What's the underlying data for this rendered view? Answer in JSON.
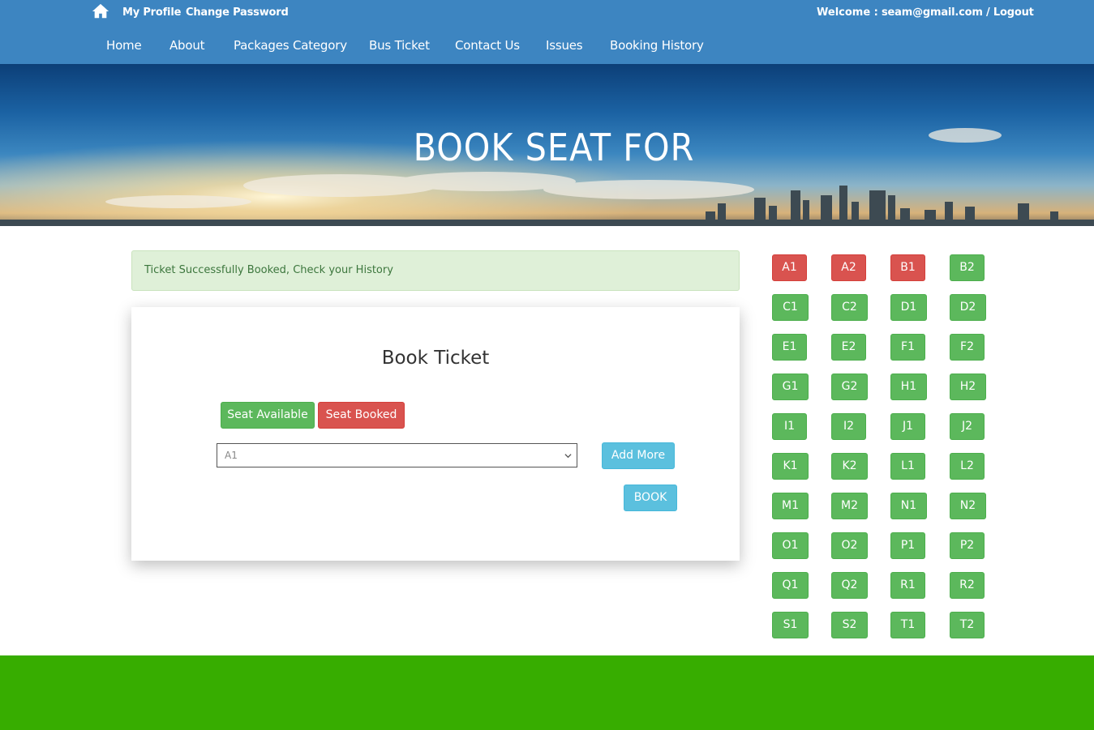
{
  "header": {
    "my_profile": "My Profile",
    "change_password": "Change Password",
    "welcome_label": "Welcome :",
    "user_logout": "seam@gmail.com / Logout",
    "bar_color": "#3d85c1"
  },
  "nav": {
    "items": [
      "Home",
      "About",
      "Packages Category",
      "Bus Ticket",
      "Contact Us",
      "Issues",
      "Booking History"
    ]
  },
  "banner": {
    "title": "BOOK SEAT FOR"
  },
  "alert": {
    "message": "Ticket Successfully Booked, Check your History"
  },
  "booking": {
    "title": "Book Ticket",
    "legend_available": "Seat Available",
    "legend_booked": "Seat Booked",
    "selected_seat": "A1",
    "add_more_label": "Add More",
    "book_label": "BOOK"
  },
  "seats": {
    "available_color": "#5cb85c",
    "booked_color": "#d9534f",
    "rows": [
      [
        {
          "label": "A1",
          "status": "booked"
        },
        {
          "label": "A2",
          "status": "booked"
        },
        {
          "label": "B1",
          "status": "booked"
        },
        {
          "label": "B2",
          "status": "available"
        }
      ],
      [
        {
          "label": "C1",
          "status": "available"
        },
        {
          "label": "C2",
          "status": "available"
        },
        {
          "label": "D1",
          "status": "available"
        },
        {
          "label": "D2",
          "status": "available"
        }
      ],
      [
        {
          "label": "E1",
          "status": "available"
        },
        {
          "label": "E2",
          "status": "available"
        },
        {
          "label": "F1",
          "status": "available"
        },
        {
          "label": "F2",
          "status": "available"
        }
      ],
      [
        {
          "label": "G1",
          "status": "available"
        },
        {
          "label": "G2",
          "status": "available"
        },
        {
          "label": "H1",
          "status": "available"
        },
        {
          "label": "H2",
          "status": "available"
        }
      ],
      [
        {
          "label": "I1",
          "status": "available"
        },
        {
          "label": "I2",
          "status": "available"
        },
        {
          "label": "J1",
          "status": "available"
        },
        {
          "label": "J2",
          "status": "available"
        }
      ],
      [
        {
          "label": "K1",
          "status": "available"
        },
        {
          "label": "K2",
          "status": "available"
        },
        {
          "label": "L1",
          "status": "available"
        },
        {
          "label": "L2",
          "status": "available"
        }
      ],
      [
        {
          "label": "M1",
          "status": "available"
        },
        {
          "label": "M2",
          "status": "available"
        },
        {
          "label": "N1",
          "status": "available"
        },
        {
          "label": "N2",
          "status": "available"
        }
      ],
      [
        {
          "label": "O1",
          "status": "available"
        },
        {
          "label": "O2",
          "status": "available"
        },
        {
          "label": "P1",
          "status": "available"
        },
        {
          "label": "P2",
          "status": "available"
        }
      ],
      [
        {
          "label": "Q1",
          "status": "available"
        },
        {
          "label": "Q2",
          "status": "available"
        },
        {
          "label": "R1",
          "status": "available"
        },
        {
          "label": "R2",
          "status": "available"
        }
      ],
      [
        {
          "label": "S1",
          "status": "available"
        },
        {
          "label": "S2",
          "status": "available"
        },
        {
          "label": "T1",
          "status": "available"
        },
        {
          "label": "T2",
          "status": "available"
        }
      ]
    ]
  },
  "footer": {
    "color": "#37ad00"
  }
}
